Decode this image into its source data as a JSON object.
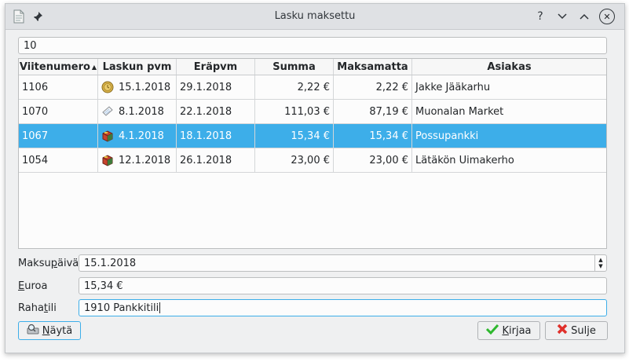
{
  "window": {
    "title": "Lasku maksettu"
  },
  "titlebar": {
    "help": "?",
    "minimize": "⌄",
    "maximize": "⌃",
    "close": "✕"
  },
  "search": {
    "value": "10"
  },
  "table": {
    "columns": [
      "Viitenumero",
      "Laskun pvm",
      "Eräpvm",
      "Summa",
      "Maksamatta",
      "Asiakas"
    ],
    "rows": [
      {
        "ref": "1106",
        "date": "15.1.2018",
        "due": "29.1.2018",
        "sum": "2,22 €",
        "unpaid": "2,22 €",
        "customer": "Jakke Jääkarhu",
        "icon": "coin-icon",
        "selected": false
      },
      {
        "ref": "1070",
        "date": "8.1.2018",
        "due": "22.1.2018",
        "sum": "111,03 €",
        "unpaid": "87,19 €",
        "customer": "Muonalan Market",
        "icon": "paper-icon",
        "selected": false
      },
      {
        "ref": "1067",
        "date": "4.1.2018",
        "due": "18.1.2018",
        "sum": "15,34 €",
        "unpaid": "15,34 €",
        "customer": "Possupankki",
        "icon": "box-icon",
        "selected": true
      },
      {
        "ref": "1054",
        "date": "12.1.2018",
        "due": "26.1.2018",
        "sum": "23,00 €",
        "unpaid": "23,00 €",
        "customer": "Lätäkön Uimakerho",
        "icon": "box-icon",
        "selected": false
      }
    ]
  },
  "form": {
    "payment_date_label": "Maksupäivä",
    "payment_date": "15.1.2018",
    "euro_label": "Euroa",
    "euro": "15,34 €",
    "account_label": "Rahatili",
    "account": "1910 Pankkitili"
  },
  "buttons": {
    "show": "Näytä",
    "post": "Kirjaa",
    "close": "Sulje"
  },
  "colors": {
    "selection": "#3daee9",
    "accept": "#2eb82e",
    "reject": "#e0302b"
  }
}
